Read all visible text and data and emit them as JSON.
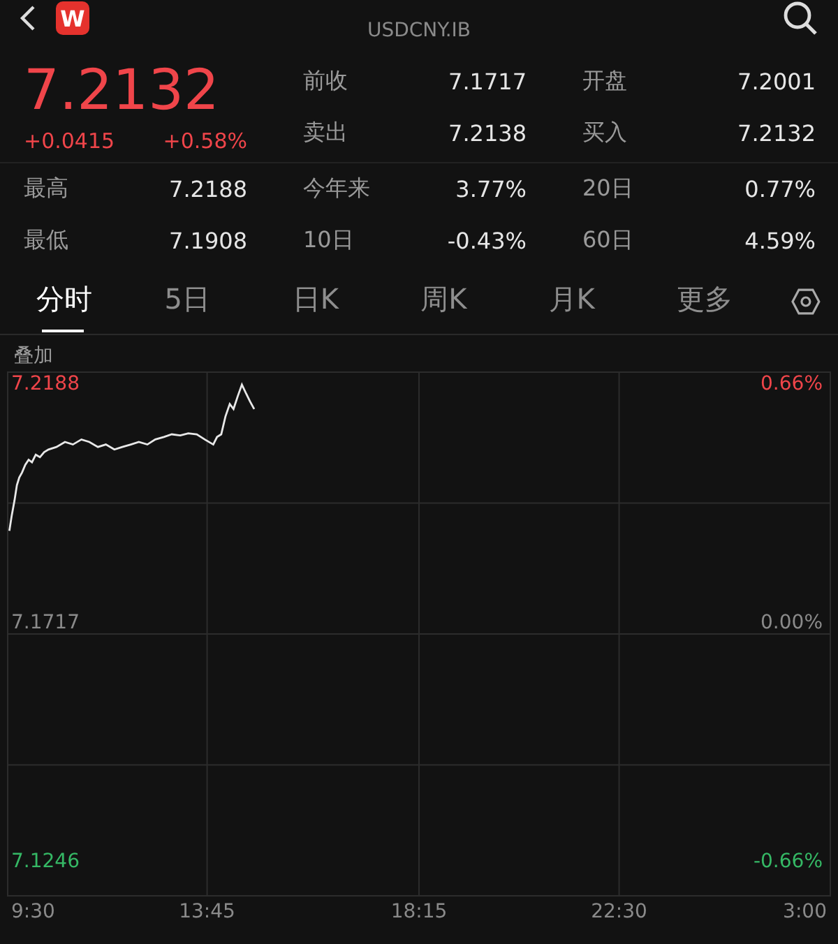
{
  "header": {
    "logo": "W",
    "subtitle": "USDCNY.IB"
  },
  "quote": {
    "price": "7.2132",
    "change": "+0.0415",
    "change_pct": "+0.58%"
  },
  "stats_top": [
    {
      "label": "前收",
      "value": "7.1717"
    },
    {
      "label": "开盘",
      "value": "7.2001"
    },
    {
      "label": "卖出",
      "value": "7.2138"
    },
    {
      "label": "买入",
      "value": "7.2132"
    }
  ],
  "stats_bottom": [
    {
      "label": "最高",
      "value": "7.2188"
    },
    {
      "label": "今年来",
      "value": "3.77%"
    },
    {
      "label": "20日",
      "value": "0.77%"
    },
    {
      "label": "最低",
      "value": "7.1908"
    },
    {
      "label": "10日",
      "value": "-0.43%"
    },
    {
      "label": "60日",
      "value": "4.59%"
    }
  ],
  "tabs": [
    {
      "label": "分时",
      "selected": true
    },
    {
      "label": "5日",
      "selected": false
    },
    {
      "label": "日K",
      "selected": false
    },
    {
      "label": "周K",
      "selected": false
    },
    {
      "label": "月K",
      "selected": false
    },
    {
      "label": "更多",
      "selected": false
    }
  ],
  "overlay_label": "叠加",
  "session_end_label": "3:00",
  "right_labels": [
    {
      "text": "0.66%",
      "color": "#f0454a"
    },
    {
      "text": "0.00%",
      "color": "#8a8a8a"
    },
    {
      "text": "-0.66%",
      "color": "#35b865"
    }
  ],
  "chart_data": {
    "type": "line",
    "xlim": [
      9.5,
      27
    ],
    "ylim": [
      7.1179,
      7.2214
    ],
    "grid": true,
    "xticks": [
      {
        "value": 9.5,
        "label": "9:30"
      },
      {
        "value": 13.75,
        "label": "13:45"
      },
      {
        "value": 18.25,
        "label": "18:15"
      },
      {
        "value": 22.5,
        "label": "22:30"
      }
    ],
    "yticks": [
      {
        "value": 7.2188,
        "label": "7.2188"
      },
      {
        "value": 7.1717,
        "label": "7.1717"
      },
      {
        "value": 7.1246,
        "label": "7.1246"
      }
    ],
    "x": [
      9.55,
      9.6,
      9.66,
      9.71,
      9.76,
      9.82,
      9.89,
      9.96,
      10.03,
      10.11,
      10.2,
      10.29,
      10.38,
      10.55,
      10.73,
      10.9,
      11.08,
      11.25,
      11.43,
      11.6,
      11.78,
      11.95,
      12.13,
      12.3,
      12.48,
      12.65,
      12.83,
      13,
      13.18,
      13.35,
      13.53,
      13.7,
      13.88,
      13.96,
      14.05,
      14.14,
      14.23,
      14.31,
      14.4,
      14.49,
      14.58,
      14.66,
      14.75
    ],
    "series": [
      {
        "color": "#e8e8e8",
        "values": [
          7.19,
          7.193,
          7.196,
          7.199,
          7.2005,
          7.2015,
          7.203,
          7.204,
          7.2035,
          7.205,
          7.2045,
          7.2055,
          7.206,
          7.2065,
          7.2075,
          7.207,
          7.208,
          7.2075,
          7.2065,
          7.207,
          7.206,
          7.2065,
          7.207,
          7.2075,
          7.207,
          7.208,
          7.2085,
          7.209,
          7.2088,
          7.2092,
          7.209,
          7.208,
          7.207,
          7.2085,
          7.209,
          7.2125,
          7.215,
          7.214,
          7.2165,
          7.2188,
          7.217,
          7.2155,
          7.214
        ]
      }
    ]
  }
}
